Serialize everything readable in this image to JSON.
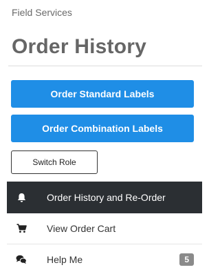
{
  "header": {
    "subtitle": "Field Services",
    "title": "Order History"
  },
  "actions": {
    "order_standard_label": "Order Standard Labels",
    "order_combination_label": "Order Combination Labels",
    "switch_role_label": "Switch Role"
  },
  "nav": {
    "items": [
      {
        "label": "Order History and Re-Order",
        "icon": "bell-icon",
        "active": true
      },
      {
        "label": "View Order Cart",
        "icon": "cart-icon",
        "active": false
      },
      {
        "label": "Help Me",
        "icon": "chat-bubbles-icon",
        "active": false,
        "badge": "5"
      }
    ]
  },
  "colors": {
    "primary_button": "#1f8ee6",
    "active_nav_bg": "#2b2f33",
    "badge_bg": "#8a8a8a"
  }
}
